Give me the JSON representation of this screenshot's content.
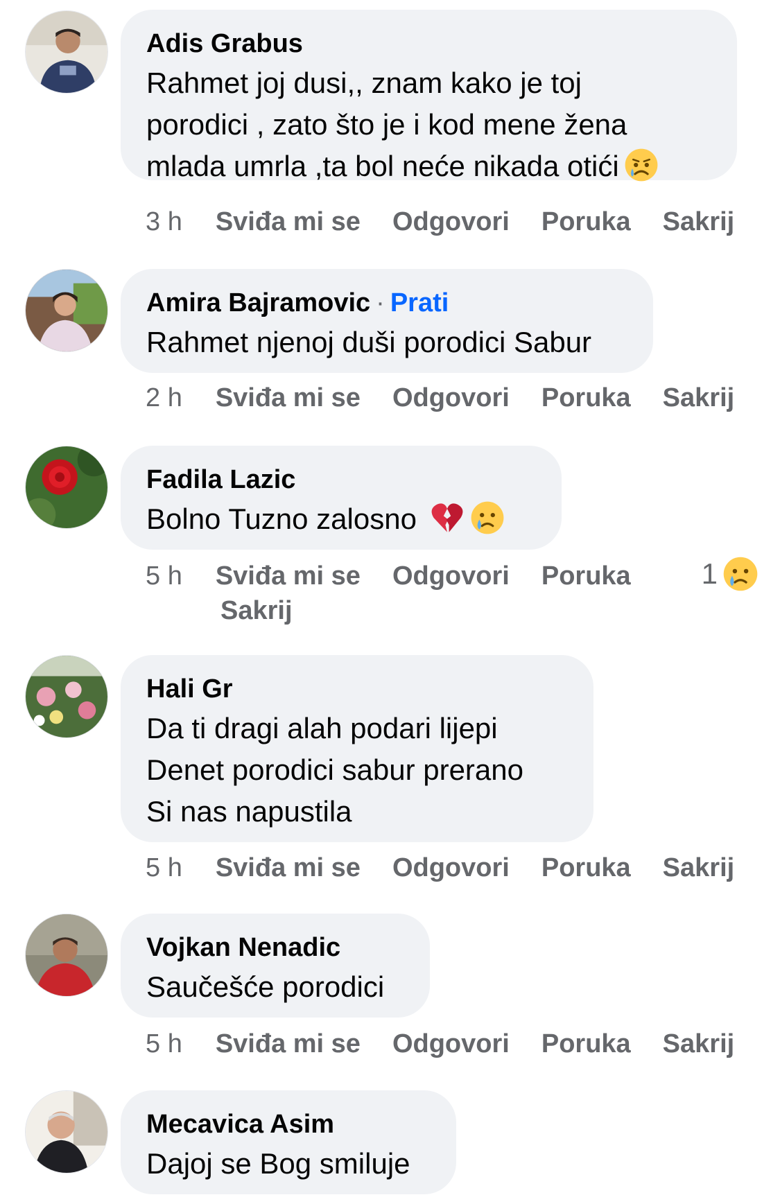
{
  "actions": {
    "like": "Sviđa mi se",
    "reply": "Odgovori",
    "message": "Poruka",
    "hide": "Sakrij"
  },
  "comments": [
    {
      "author": "Adis Grabus",
      "text": "Rahmet joj dusi,, znam kako je toj\nporodici , zato što je i kod mene žena\nmlada umrla ,ta bol neće nikada otići",
      "time": "3 h",
      "emoji": "sad-face"
    },
    {
      "author": "Amira Bajramovic",
      "follow": "Prati",
      "text": "Rahmet njenoj duši porodici Sabur",
      "time": "2 h"
    },
    {
      "author": "Fadila Lazic",
      "text": "Bolno Tuzno zalosno",
      "time": "5 h",
      "emoji": "broken-heart, crying-face",
      "reaction_count": "1",
      "reaction": "crying-face"
    },
    {
      "author": "Hali Gr",
      "text": "Da ti dragi alah  podari lijepi\nDenet porodici sabur  prerano\nSi nas napustila",
      "time": "5 h"
    },
    {
      "author": "Vojkan Nenadic",
      "text": "Saučešće porodici",
      "time": "5 h"
    },
    {
      "author": "Mecavica Asim",
      "text": "Dajoj se Bog smiluje"
    }
  ]
}
